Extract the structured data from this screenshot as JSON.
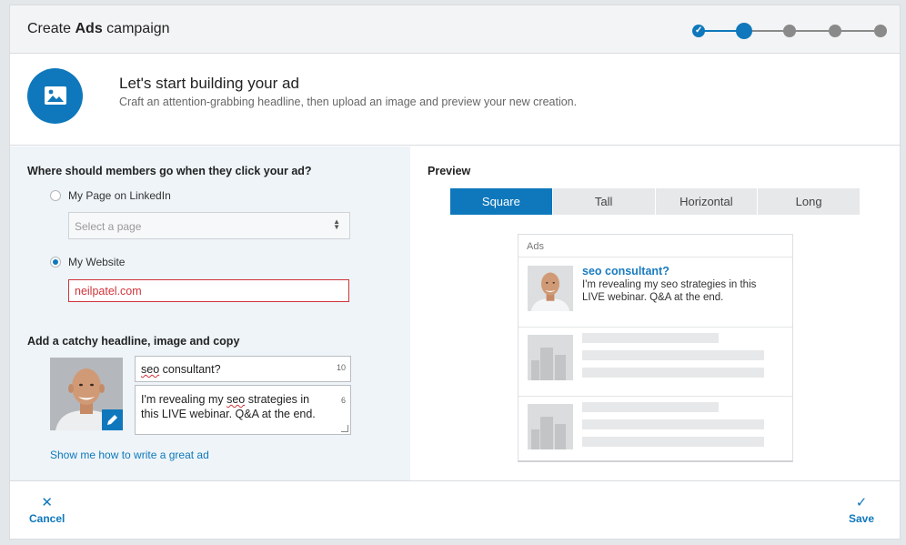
{
  "header": {
    "title_prefix": "Create",
    "title_bold": "Ads",
    "title_suffix": "campaign",
    "steps": [
      {
        "state": "done",
        "check": "✓"
      },
      {
        "state": "current"
      },
      {
        "state": "todo"
      },
      {
        "state": "todo"
      },
      {
        "state": "todo"
      }
    ]
  },
  "intro": {
    "icon": "image-icon",
    "title": "Let's start building your ad",
    "subtitle": "Craft an attention-grabbing headline, then upload an image and preview your new creation."
  },
  "destination": {
    "question": "Where should members go when they click your ad?",
    "option_page": "My Page on LinkedIn",
    "page_select_placeholder": "Select a page",
    "option_website": "My Website",
    "selected": "website",
    "website_url": "neilpatel.com"
  },
  "creative": {
    "title": "Add a catchy headline, image and copy",
    "headline_prefix": "",
    "headline_word": "seo",
    "headline_rest": " consultant?",
    "headline_count": "10",
    "copy_line1_prefix": "I'm revealing my ",
    "copy_word": "seo",
    "copy_line1_suffix": " strategies in",
    "copy_line2": "this LIVE webinar. Q&A at the end.",
    "copy_count": "6",
    "help_link": "Show me how to write a great ad"
  },
  "preview": {
    "title": "Preview",
    "tabs": [
      "Square",
      "Tall",
      "Horizontal",
      "Long"
    ],
    "active_tab": "Square",
    "card_label": "Ads",
    "ad_headline": "seo consultant?",
    "ad_copy": "I'm revealing my seo strategies in this LIVE webinar. Q&A at the end."
  },
  "footer": {
    "cancel_icon": "✕",
    "cancel_label": "Cancel",
    "save_icon": "✓",
    "save_label": "Save"
  },
  "colors": {
    "accent": "#0f78bc",
    "error": "#d0343a",
    "panel_bg": "#eef4f8"
  }
}
